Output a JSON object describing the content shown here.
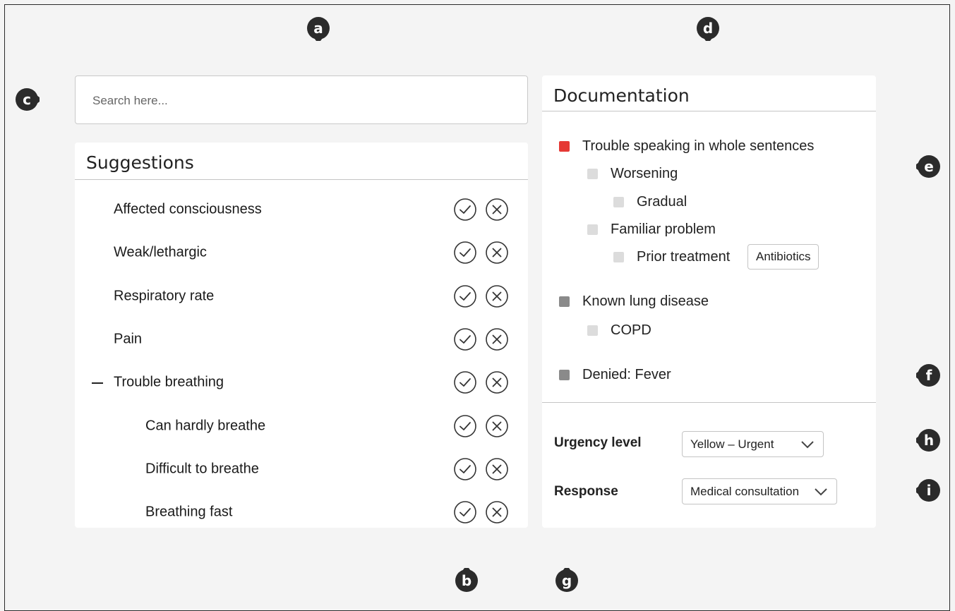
{
  "markers": [
    {
      "id": "a",
      "label": "a"
    },
    {
      "id": "b",
      "label": "b"
    },
    {
      "id": "c",
      "label": "c"
    },
    {
      "id": "d",
      "label": "d"
    },
    {
      "id": "e",
      "label": "e"
    },
    {
      "id": "f",
      "label": "f"
    },
    {
      "id": "g",
      "label": "g"
    },
    {
      "id": "h",
      "label": "h"
    },
    {
      "id": "i",
      "label": "i"
    }
  ],
  "search": {
    "placeholder": "Search here...",
    "icon": "search-icon"
  },
  "suggestions": {
    "title": "Suggestions",
    "items": [
      {
        "label": "Affected consciousness",
        "level": 0
      },
      {
        "label": "Weak/lethargic",
        "level": 0
      },
      {
        "label": "Respiratory rate",
        "level": 0
      },
      {
        "label": "Pain",
        "level": 0
      },
      {
        "label": "Trouble breathing",
        "level": 0,
        "expanded": true
      },
      {
        "label": "Can hardly breathe",
        "level": 1
      },
      {
        "label": "Difficult to breathe",
        "level": 1
      },
      {
        "label": "Breathing fast",
        "level": 1
      }
    ],
    "accept_icon": "check-circle-icon",
    "reject_icon": "x-circle-icon"
  },
  "documentation": {
    "title": "Documentation",
    "items": [
      {
        "label": "Trouble speaking in whole sentences",
        "level": 0,
        "status": "urgent"
      },
      {
        "label": "Worsening",
        "level": 1,
        "status": "sub"
      },
      {
        "label": "Gradual",
        "level": 2,
        "status": "sub"
      },
      {
        "label": "Familiar problem",
        "level": 1,
        "status": "sub"
      },
      {
        "label": "Prior treatment",
        "level": 2,
        "status": "sub",
        "tag": "Antibiotics"
      },
      {
        "label": "Known lung disease",
        "level": 0,
        "status": "neutral"
      },
      {
        "label": "COPD",
        "level": 1,
        "status": "sub"
      },
      {
        "label": "Denied: Fever",
        "level": 0,
        "status": "neutral"
      }
    ],
    "urgency": {
      "label": "Urgency level",
      "value": "Yellow – Urgent"
    },
    "response": {
      "label": "Response",
      "value": "Medical consultation"
    }
  },
  "colors": {
    "urgent": "#e53935",
    "neutral": "#8a8a8a",
    "sub": "#dcdcdc",
    "marker": "#2b2b2b"
  }
}
